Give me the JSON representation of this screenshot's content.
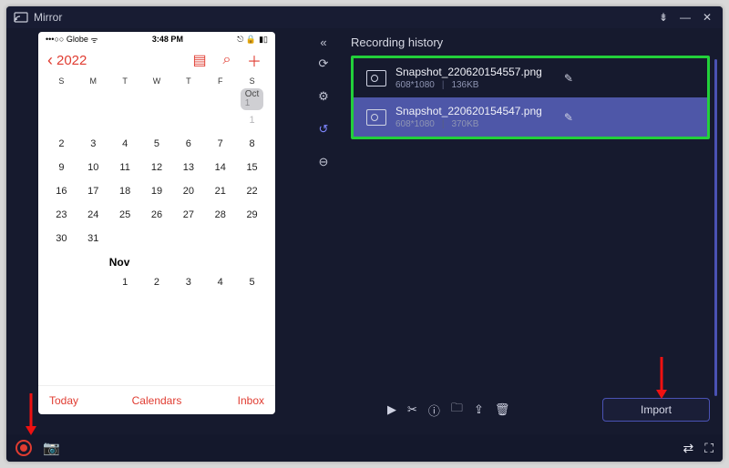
{
  "app": {
    "title": "Mirror"
  },
  "phone": {
    "status": {
      "carrier_prefix": "•••○○",
      "carrier": "Globe",
      "wifi": "ᯤ",
      "time": "3:48 PM",
      "batt": "▮▯",
      "extra": "⎋ 🔒"
    },
    "year": "2022",
    "dow": [
      "S",
      "M",
      "T",
      "W",
      "T",
      "F",
      "S"
    ],
    "month1": {
      "chip": "Oct",
      "chip_day": "1",
      "rows": [
        [
          "",
          "",
          "",
          "",
          "",
          "",
          "1"
        ],
        [
          "2",
          "3",
          "4",
          "5",
          "6",
          "7",
          "8"
        ],
        [
          "9",
          "10",
          "11",
          "12",
          "13",
          "14",
          "15"
        ],
        [
          "16",
          "17",
          "18",
          "19",
          "20",
          "21",
          "22"
        ],
        [
          "23",
          "24",
          "25",
          "26",
          "27",
          "28",
          "29"
        ],
        [
          "30",
          "31",
          "",
          "",
          "",
          "",
          ""
        ]
      ]
    },
    "month2": {
      "label": "Nov",
      "rows": [
        [
          "",
          "",
          "1",
          "2",
          "3",
          "4",
          "5"
        ]
      ]
    },
    "tabs": {
      "today": "Today",
      "calendars": "Calendars",
      "inbox": "Inbox"
    },
    "icons": {
      "list": "▤",
      "search": "⌕",
      "add": "＋",
      "back": "‹"
    }
  },
  "right": {
    "title": "Recording history",
    "sidebar_icons": {
      "collapse": "«",
      "refresh": "⟳",
      "settings": "⚙",
      "history": "↺",
      "remove": "⊖"
    },
    "items": [
      {
        "name": "Snapshot_220620154557.png",
        "dim": "608*1080",
        "size": "136KB",
        "selected": false
      },
      {
        "name": "Snapshot_220620154547.png",
        "dim": "608*1080",
        "size": "370KB",
        "selected": true
      }
    ],
    "toolbar": {
      "play": "▶",
      "cut": "✂",
      "info": "ⓘ",
      "folder": "🗀",
      "share": "⇪",
      "delete": "🗑"
    },
    "import": "Import"
  },
  "bottom": {
    "settings": "⇄",
    "fullscreen": "⛶",
    "camera": "📷"
  },
  "winbtns": {
    "pin": "⇟",
    "min": "—",
    "close": "✕"
  }
}
